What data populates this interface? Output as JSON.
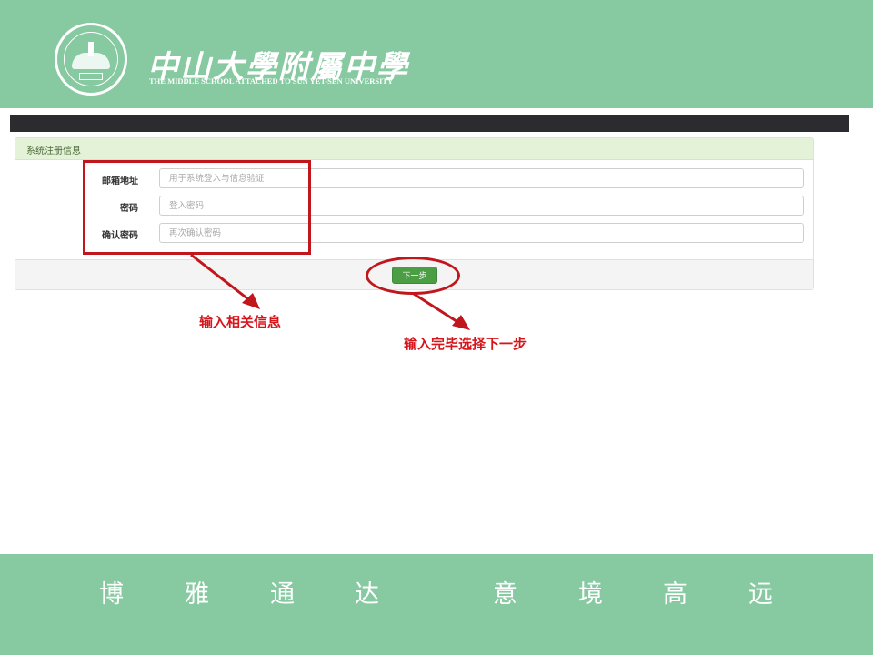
{
  "colors": {
    "header_band": "#87c9a0",
    "navbar": "#2c2c30",
    "panel_heading": "#e4f2d8",
    "button": "#4c9e45",
    "annotation": "#c0161c"
  },
  "header": {
    "logo_icon": "school-seal-logo",
    "school_name": "中山大學附屬中學",
    "school_name_en": "THE MIDDLE SCHOOL ATTACHED TO  SUN YET-SEN UNIVERSITY"
  },
  "form": {
    "panel_title": "系统注册信息",
    "fields": [
      {
        "label": "邮箱地址",
        "value": "",
        "placeholder": "用于系统登入与信息验证"
      },
      {
        "label": "密码",
        "value": "",
        "placeholder": "登入密码"
      },
      {
        "label": "确认密码",
        "value": "",
        "placeholder": "再次确认密码"
      }
    ],
    "next_button_label": "下一步"
  },
  "annotations": {
    "input_hint": "输入相关信息",
    "next_hint": "输入完毕选择下一步"
  },
  "footer": {
    "motto": [
      "博",
      "雅",
      "通",
      "达",
      "意",
      "境",
      "高",
      "远"
    ]
  }
}
